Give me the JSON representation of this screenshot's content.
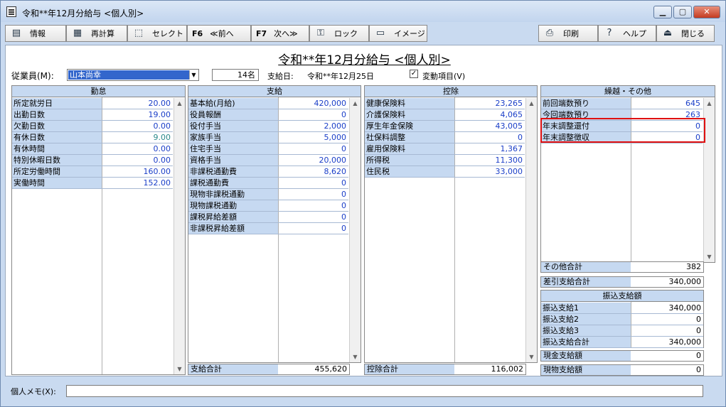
{
  "window": {
    "title": "令和**年12月分給与 <個人別>"
  },
  "toolbar": {
    "info": "情報",
    "recalc": "再計算",
    "select": "セレクト",
    "prev_key": "F6",
    "prev": "≪前へ",
    "next_key": "F7",
    "next": "次へ≫",
    "lock": "ロック",
    "image": "イメージ",
    "print": "印刷",
    "help": "ヘルプ",
    "close": "閉じる"
  },
  "header": {
    "title": "令和**年12月分給与 <個人別>",
    "employee_label": "従業員(M):",
    "employee_value": "山本尚幸",
    "count": "14名",
    "pay_date_label": "支給日:",
    "pay_date": "令和**年12月25日",
    "variable_checked": "✓",
    "variable_label": "変動項目(V)"
  },
  "attendance": {
    "header": "勤怠",
    "rows": [
      {
        "label": "所定就労日",
        "value": "20.00"
      },
      {
        "label": "出勤日数",
        "value": "19.00"
      },
      {
        "label": "欠勤日数",
        "value": "0.00"
      },
      {
        "label": "有休日数",
        "value": "9.00"
      },
      {
        "label": "有休時間",
        "value": "0.00"
      },
      {
        "label": "特別休暇日数",
        "value": "0.00"
      },
      {
        "label": "所定労働時間",
        "value": "160.00"
      },
      {
        "label": "実働時間",
        "value": "152.00"
      }
    ]
  },
  "payment": {
    "header": "支給",
    "rows": [
      {
        "label": "基本給(月給)",
        "value": "420,000"
      },
      {
        "label": "役員報酬",
        "value": "0"
      },
      {
        "label": "役付手当",
        "value": "2,000"
      },
      {
        "label": "家族手当",
        "value": "5,000"
      },
      {
        "label": "住宅手当",
        "value": "0"
      },
      {
        "label": "資格手当",
        "value": "20,000"
      },
      {
        "label": "非課税通勤費",
        "value": "8,620"
      },
      {
        "label": "課税通勤費",
        "value": "0"
      },
      {
        "label": "現物非課税通勤",
        "value": "0"
      },
      {
        "label": "現物課税通勤",
        "value": "0"
      },
      {
        "label": "課税昇給差額",
        "value": "0"
      },
      {
        "label": "非課税昇給差額",
        "value": "0"
      }
    ],
    "total_label": "支給合計",
    "total_value": "455,620"
  },
  "deduction": {
    "header": "控除",
    "rows": [
      {
        "label": "健康保険料",
        "value": "23,265"
      },
      {
        "label": "介護保険料",
        "value": "4,065"
      },
      {
        "label": "厚生年金保険",
        "value": "43,005"
      },
      {
        "label": "社保料調整",
        "value": "0"
      },
      {
        "label": "雇用保険料",
        "value": "1,367"
      },
      {
        "label": "所得税",
        "value": "11,300"
      },
      {
        "label": "住民税",
        "value": "33,000"
      }
    ],
    "total_label": "控除合計",
    "total_value": "116,002"
  },
  "carryover": {
    "header": "繰越・その他",
    "rows": [
      {
        "label": "前回端数預り",
        "value": "645"
      },
      {
        "label": "今回端数預り",
        "value": "263"
      },
      {
        "label": "年末調整還付",
        "value": "0"
      },
      {
        "label": "年末調整徴収",
        "value": "0"
      }
    ],
    "other_total_label": "その他合計",
    "other_total_value": "382"
  },
  "net": {
    "label": "差引支給合計",
    "value": "340,000"
  },
  "transfer": {
    "header": "振込支給額",
    "rows": [
      {
        "label": "振込支給1",
        "value": "340,000"
      },
      {
        "label": "振込支給2",
        "value": "0"
      },
      {
        "label": "振込支給3",
        "value": "0"
      },
      {
        "label": "振込支給合計",
        "value": "340,000"
      }
    ]
  },
  "cash": {
    "label": "現金支給額",
    "value": "0"
  },
  "inkind": {
    "label": "現物支給額",
    "value": "0"
  },
  "memo": {
    "label": "個人メモ(X):",
    "value": ""
  }
}
